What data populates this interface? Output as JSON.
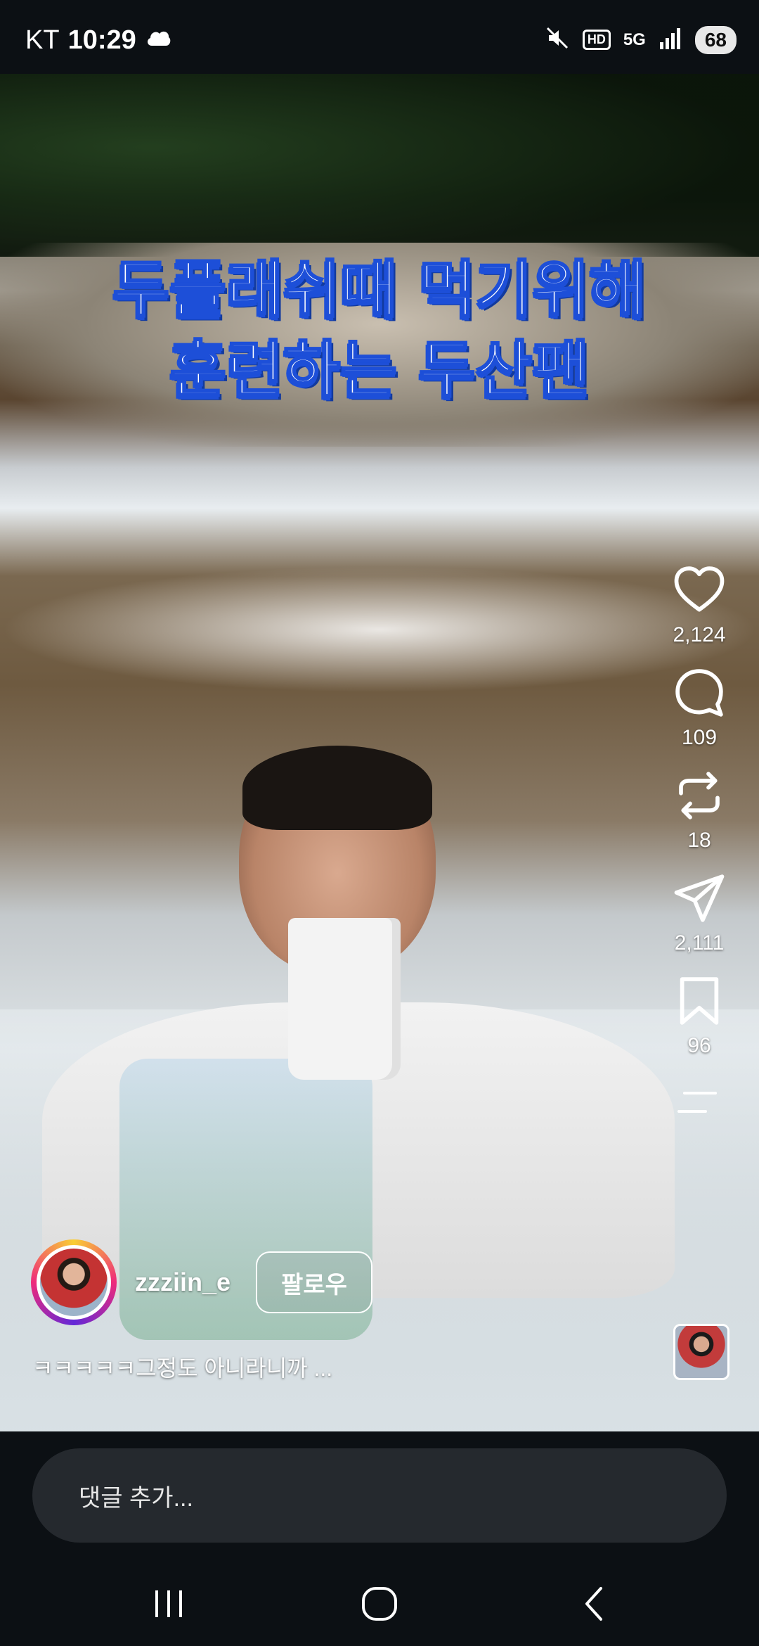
{
  "status_bar": {
    "carrier": "KT",
    "time": "10:29",
    "network": "5G",
    "battery": "68",
    "icons": [
      "cloud-icon",
      "mute-icon",
      "hd-icon",
      "5g-icon",
      "signal-icon",
      "battery-icon"
    ]
  },
  "video": {
    "title_line1": "두플래쉬때 먹기위해",
    "title_line2": "훈련하는 두산팬",
    "title_color": "#ffffff",
    "title_outline_color": "#1d4fd8"
  },
  "actions": {
    "likes": "2,124",
    "comments": "109",
    "reposts": "18",
    "shares": "2,111",
    "saves": "96",
    "icons": [
      "heart-icon",
      "comment-icon",
      "repost-icon",
      "share-icon",
      "bookmark-icon",
      "more-icon"
    ]
  },
  "author": {
    "username": "zzziin_e",
    "follow_label": "팔로우"
  },
  "caption": "ㅋㅋㅋㅋㅋ그정도 아니라니까 ...",
  "comment_bar": {
    "placeholder": "댓글 추가..."
  },
  "nav": {
    "icons": [
      "recents-icon",
      "home-icon",
      "back-icon"
    ]
  }
}
